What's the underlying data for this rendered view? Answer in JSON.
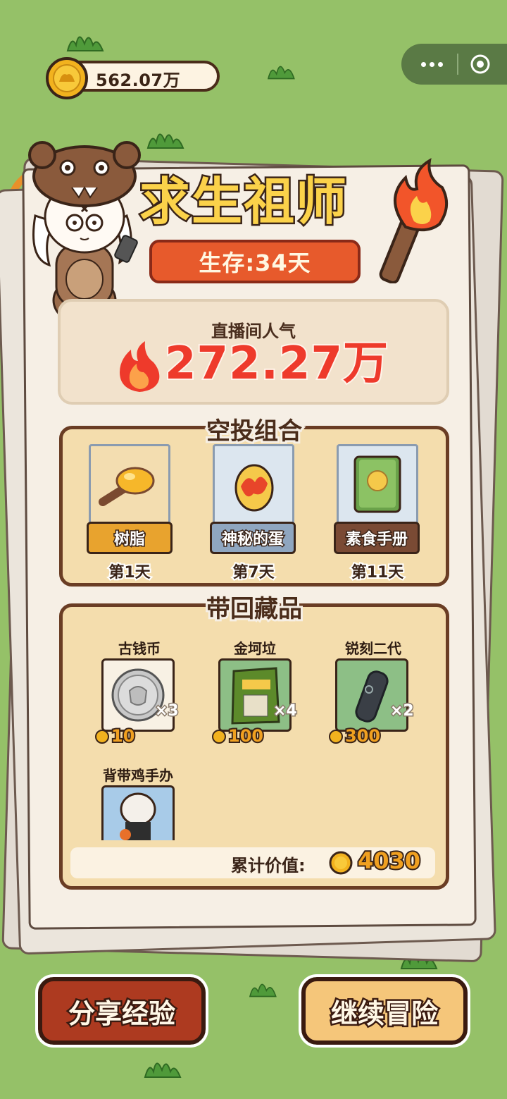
{
  "top_bar": {
    "coin_balance": "562.07万",
    "menu_icon": "more-dots-icon",
    "close_icon": "target-circle-icon"
  },
  "header": {
    "title": "求生祖师",
    "survival_days": "生存:34天"
  },
  "popularity": {
    "label": "直播间人气",
    "value": "272.27万"
  },
  "airdrop": {
    "title": "空投组合",
    "items": [
      {
        "name": "树脂",
        "day": "第1天",
        "icon": "resin-icon",
        "label_color": "#e8a32e"
      },
      {
        "name": "神秘的蛋",
        "day": "第7天",
        "icon": "mystery-egg-icon",
        "label_color": "#8fa6c0"
      },
      {
        "name": "素食手册",
        "day": "第11天",
        "icon": "vegetarian-manual-icon",
        "label_color": "#7a4a34"
      }
    ]
  },
  "collectibles": {
    "title": "带回藏品",
    "items": [
      {
        "name": "古钱币",
        "qty": "×3",
        "price": "10",
        "icon": "ancient-coin-icon"
      },
      {
        "name": "金坷垃",
        "qty": "×4",
        "price": "100",
        "icon": "fertilizer-bag-icon"
      },
      {
        "name": "锐刻二代",
        "qty": "×2",
        "price": "300",
        "icon": "e-cigarette-icon"
      },
      {
        "name": "背带鸡手办",
        "icon": "chicken-figure-icon"
      }
    ],
    "total_label": "累计价值:",
    "total_value": "4030"
  },
  "buttons": {
    "share": "分享经验",
    "continue": "继续冒险"
  },
  "colors": {
    "background": "#95c168",
    "title_yellow": "#fbd24a",
    "popularity_red": "#ee3a2b",
    "share_button": "#ad3a20",
    "continue_button": "#f5c67a"
  }
}
